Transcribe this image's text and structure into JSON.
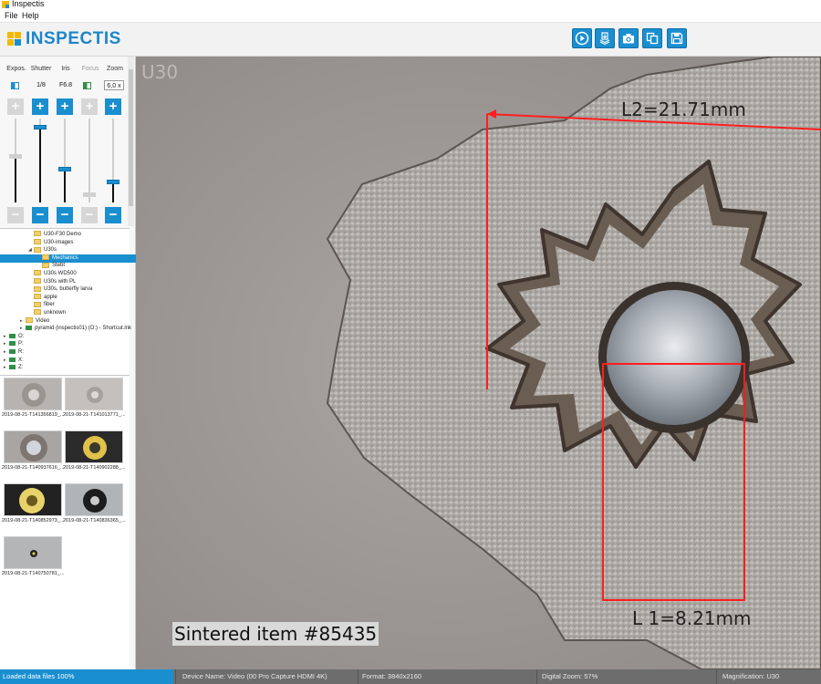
{
  "window": {
    "title": "Inspectis"
  },
  "menu": {
    "file": "File",
    "help": "Help"
  },
  "brand": {
    "name": "INSPECTIS",
    "colors": {
      "accent": "#1a8fd0",
      "logo_yellow": "#f5b800"
    }
  },
  "toolbar": {
    "buttons": [
      {
        "icon": "play-icon"
      },
      {
        "icon": "stack-save-icon"
      },
      {
        "icon": "camera-icon"
      },
      {
        "icon": "copy-icon"
      },
      {
        "icon": "floppy-disk-icon"
      }
    ]
  },
  "controls": {
    "exposure": {
      "label": "Expos.",
      "enabled": true,
      "level": 0.55
    },
    "shutter": {
      "label": "Shutter",
      "value": "1/8",
      "enabled": true,
      "level": 0.9
    },
    "iris": {
      "label": "Iris",
      "value": "F6.8",
      "enabled": true,
      "level": 0.4
    },
    "focus": {
      "label": "Focus",
      "enabled": false,
      "level": 0.1
    },
    "zoom": {
      "label": "Zoom",
      "value": "6,0 x",
      "enabled": true,
      "level": 0.25
    }
  },
  "tree": {
    "items": [
      {
        "label": "U30-F30 Demo",
        "type": "folder",
        "indent": 3
      },
      {
        "label": "U30-images",
        "type": "folder",
        "indent": 3
      },
      {
        "label": "U30s",
        "type": "folder",
        "indent": 3,
        "expanded": true
      },
      {
        "label": "Mechanics",
        "type": "folder",
        "indent": 4,
        "selected": true
      },
      {
        "label": "Stebt",
        "type": "folder",
        "indent": 4
      },
      {
        "label": "U30s WD500",
        "type": "folder",
        "indent": 3
      },
      {
        "label": "U30s with PL",
        "type": "folder",
        "indent": 3
      },
      {
        "label": "U30s, butterfly larva",
        "type": "folder",
        "indent": 3
      },
      {
        "label": "apple",
        "type": "folder",
        "indent": 3
      },
      {
        "label": "fiber",
        "type": "folder",
        "indent": 3
      },
      {
        "label": "unknown",
        "type": "folder",
        "indent": 3
      },
      {
        "label": "Video",
        "type": "folder",
        "indent": 2,
        "collapsed": true
      },
      {
        "label": "pyramid (inspectis01) (O:) - Shortcut.lnk",
        "type": "drive",
        "indent": 2,
        "collapsed": true
      },
      {
        "label": "O:",
        "type": "drive",
        "indent": 0,
        "collapsed": true
      },
      {
        "label": "P:",
        "type": "drive",
        "indent": 0,
        "collapsed": true
      },
      {
        "label": "R:",
        "type": "drive",
        "indent": 0,
        "collapsed": true
      },
      {
        "label": "X:",
        "type": "drive",
        "indent": 0,
        "collapsed": true
      },
      {
        "label": "Z:",
        "type": "drive",
        "indent": 0,
        "collapsed": true
      }
    ]
  },
  "thumbnails": [
    {
      "caption": "2019-08-21-T141356819_...",
      "kind": "gear-light"
    },
    {
      "caption": "2019-08-21-T141013771_...",
      "kind": "gear-small"
    },
    {
      "caption": "2019-08-21-T140937616_...",
      "kind": "gear-ball"
    },
    {
      "caption": "2019-08-21-T140902288_...",
      "kind": "gold-dark"
    },
    {
      "caption": "2019-08-21-T140852973_...",
      "kind": "gold-dark2"
    },
    {
      "caption": "2019-08-21-T140836365_...",
      "kind": "ring-dark"
    },
    {
      "caption": "2019-08-21-T140750781_...",
      "kind": "tiny-dot"
    }
  ],
  "viewer": {
    "magnification_label": "U30",
    "annotations": [
      {
        "text": "L2=21.71mm"
      },
      {
        "text": "L 1=8.21mm"
      }
    ],
    "caption": "Sintered item #85435",
    "measure_color": "#ff1e1e"
  },
  "status": {
    "loaded": "Loaded data files 100%",
    "device": "Device Name: Video (00 Pro Capture HDMI 4K)",
    "format": "Format: 3840x2160",
    "digital_zoom": "Digital Zoom: 57%",
    "magnification": "Magnification: U30",
    "load_progress": 1.0
  }
}
